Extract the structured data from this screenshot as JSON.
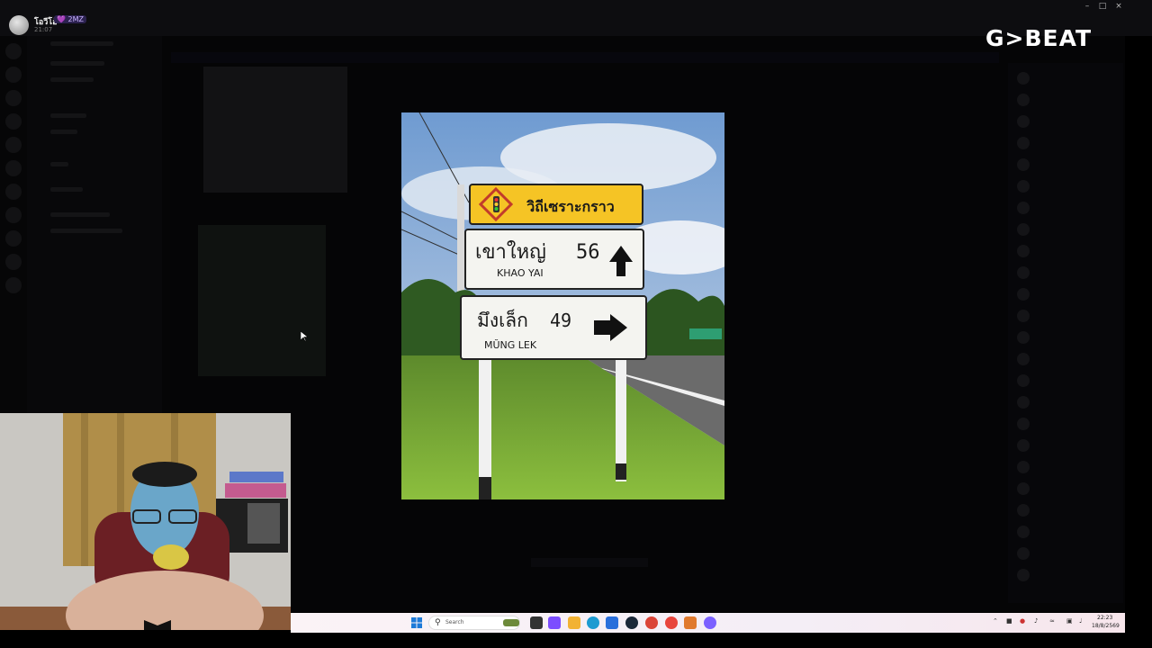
{
  "viewer": {
    "user_name": "โอวีโอ้",
    "user_badge": "💜 2MZ",
    "user_time": "21:07"
  },
  "sign": {
    "top_label": "วิถีเซราะกราว",
    "row1_thai": "เขาใหญ่",
    "row1_distance": "56",
    "row1_english": "KHAO YAI",
    "row2_thai": "มึงเล็ก",
    "row2_distance": "49",
    "row2_english": "MŬNG LEK"
  },
  "logo": {
    "text": "G>BEAT"
  },
  "taskbar": {
    "search_placeholder": "Search",
    "clock_time": "22:23",
    "clock_date": "18/8/2569",
    "apps": [
      {
        "icon": "file-explorer-icon",
        "color": "#f4b400"
      },
      {
        "icon": "copilot-icon",
        "color": "#7c4dff"
      },
      {
        "icon": "files-icon",
        "color": "#f2b233"
      },
      {
        "icon": "edge-icon",
        "color": "#1d9bd1"
      },
      {
        "icon": "store-icon",
        "color": "#2a6fdb"
      },
      {
        "icon": "steam-icon",
        "color": "#1b2838"
      },
      {
        "icon": "chrome-icon",
        "color": "#db4437"
      },
      {
        "icon": "chrome-alt-icon",
        "color": "#e8453c"
      },
      {
        "icon": "game-icon",
        "color": "#e07a2e"
      },
      {
        "icon": "messenger-icon",
        "color": "#7b61ff"
      }
    ]
  },
  "colors": {
    "sign_yellow": "#f5c425",
    "sign_white": "#f4f4f0",
    "sky": "#7fa7d6",
    "grass": "#6f9c34"
  }
}
